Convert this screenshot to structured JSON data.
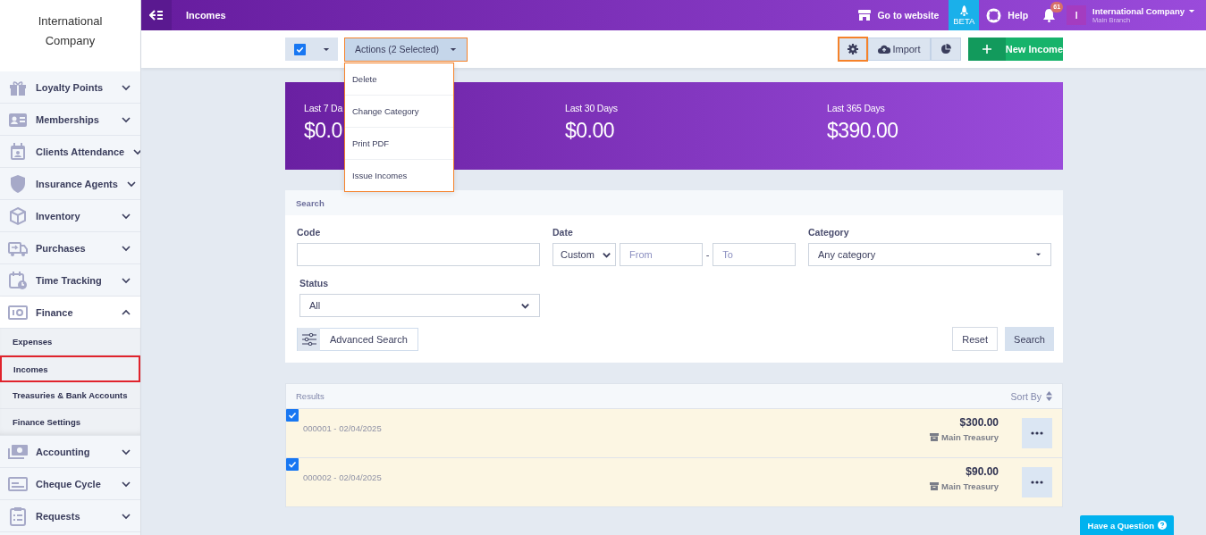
{
  "sidebar": {
    "brand": "International Company",
    "items": [
      {
        "label": "Loyalty Points",
        "expanded": false
      },
      {
        "label": "Memberships",
        "expanded": false
      },
      {
        "label": "Clients Attendance",
        "expanded": false
      },
      {
        "label": "Insurance Agents",
        "expanded": false
      },
      {
        "label": "Inventory",
        "expanded": false
      },
      {
        "label": "Purchases",
        "expanded": false
      },
      {
        "label": "Time Tracking",
        "expanded": false
      },
      {
        "label": "Finance",
        "expanded": true,
        "children": [
          {
            "label": "Expenses",
            "selected": false
          },
          {
            "label": "Incomes",
            "selected": true
          },
          {
            "label": "Treasuries & Bank Accounts",
            "selected": false
          },
          {
            "label": "Finance Settings",
            "selected": false
          }
        ]
      },
      {
        "label": "Accounting",
        "expanded": false
      },
      {
        "label": "Cheque Cycle",
        "expanded": false
      },
      {
        "label": "Requests",
        "expanded": false
      }
    ]
  },
  "topbar": {
    "title": "Incomes",
    "website_link": "Go to website",
    "beta_label": "BETA",
    "help_link": "Help",
    "notifications_count": "61",
    "account": {
      "avatar_letter": "I",
      "name": "International Company",
      "branch": "Main Branch"
    }
  },
  "toolbar": {
    "select_all": {
      "checked": true
    },
    "actions": {
      "label": "Actions (2 Selected)",
      "expanded": true,
      "menu": [
        "Delete",
        "Change Category",
        "Print PDF",
        "Issue Incomes"
      ]
    },
    "import_label": "Import",
    "new_label": "New Income"
  },
  "stats": [
    {
      "label": "Last 7 Da",
      "value": "$0.0"
    },
    {
      "label": "Last 30 Days",
      "value": "$0.00"
    },
    {
      "label": "Last 365 Days",
      "value": "$390.00"
    }
  ],
  "search": {
    "title": "Search",
    "fields": [
      {
        "kind": "text",
        "label": "Code"
      },
      {
        "kind": "date-range",
        "label": "Date",
        "mode": "Custom",
        "from_placeholder": "From",
        "separator": "-",
        "to_placeholder": "To"
      },
      {
        "kind": "combo",
        "label": "Category",
        "value": "Any category"
      },
      {
        "kind": "select",
        "label": "Status",
        "value": "All"
      }
    ],
    "advanced_label": "Advanced Search",
    "reset_label": "Reset",
    "search_label": "Search"
  },
  "results": {
    "title": "Results",
    "sort_label": "Sort By",
    "rows": [
      {
        "checked": true,
        "code_date": "000001 - 02/04/2025",
        "amount": "$300.00",
        "treasury": "Main Treasury"
      },
      {
        "checked": true,
        "code_date": "000002 - 02/04/2025",
        "amount": "$90.00",
        "treasury": "Main Treasury"
      }
    ]
  },
  "help_button": "Have a Question"
}
